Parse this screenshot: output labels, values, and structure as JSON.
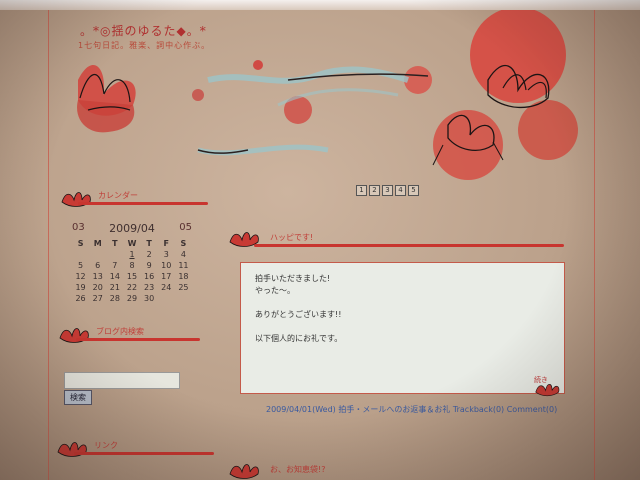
{
  "blog": {
    "title": "。*◎揺のゆるた◆。*",
    "subtitle": "1七句日記。雅楽、詞中心作ぶ。"
  },
  "sidebar": {
    "calendar_heading": "カレンダー",
    "calendar": {
      "prev": "03",
      "current": "2009/04",
      "next": "05",
      "weekdays": [
        "S",
        "M",
        "T",
        "W",
        "T",
        "F",
        "S"
      ],
      "weeks": [
        [
          "",
          "",
          "",
          "1",
          "2",
          "3",
          "4"
        ],
        [
          "5",
          "6",
          "7",
          "8",
          "9",
          "10",
          "11"
        ],
        [
          "12",
          "13",
          "14",
          "15",
          "16",
          "17",
          "18"
        ],
        [
          "19",
          "20",
          "21",
          "22",
          "23",
          "24",
          "25"
        ],
        [
          "26",
          "27",
          "28",
          "29",
          "30",
          "",
          ""
        ]
      ]
    },
    "search_heading": "ブログ内検索",
    "search_button": "検索",
    "link_heading": "リンク"
  },
  "pager": {
    "pages": [
      "1",
      "2",
      "3",
      "4",
      "5"
    ]
  },
  "entry": {
    "heading": "ハッピです!",
    "lines": [
      "拍手いただきました!",
      "やった～。",
      "ありがとうございます!!",
      "以下個人的にお礼です。"
    ],
    "more_label": "続き",
    "meta_date": "2009/04/01(Wed)",
    "meta_category": "拍手・メールへのお返事＆お礼",
    "meta_trackback": "Trackback(0)",
    "meta_comment": "Comment(0)"
  },
  "entry2": {
    "heading": "お、お知恵袋!?"
  },
  "colors": {
    "accent": "#c8352f",
    "link": "#3a5aa0",
    "entry_bg": "#e9ece6"
  }
}
